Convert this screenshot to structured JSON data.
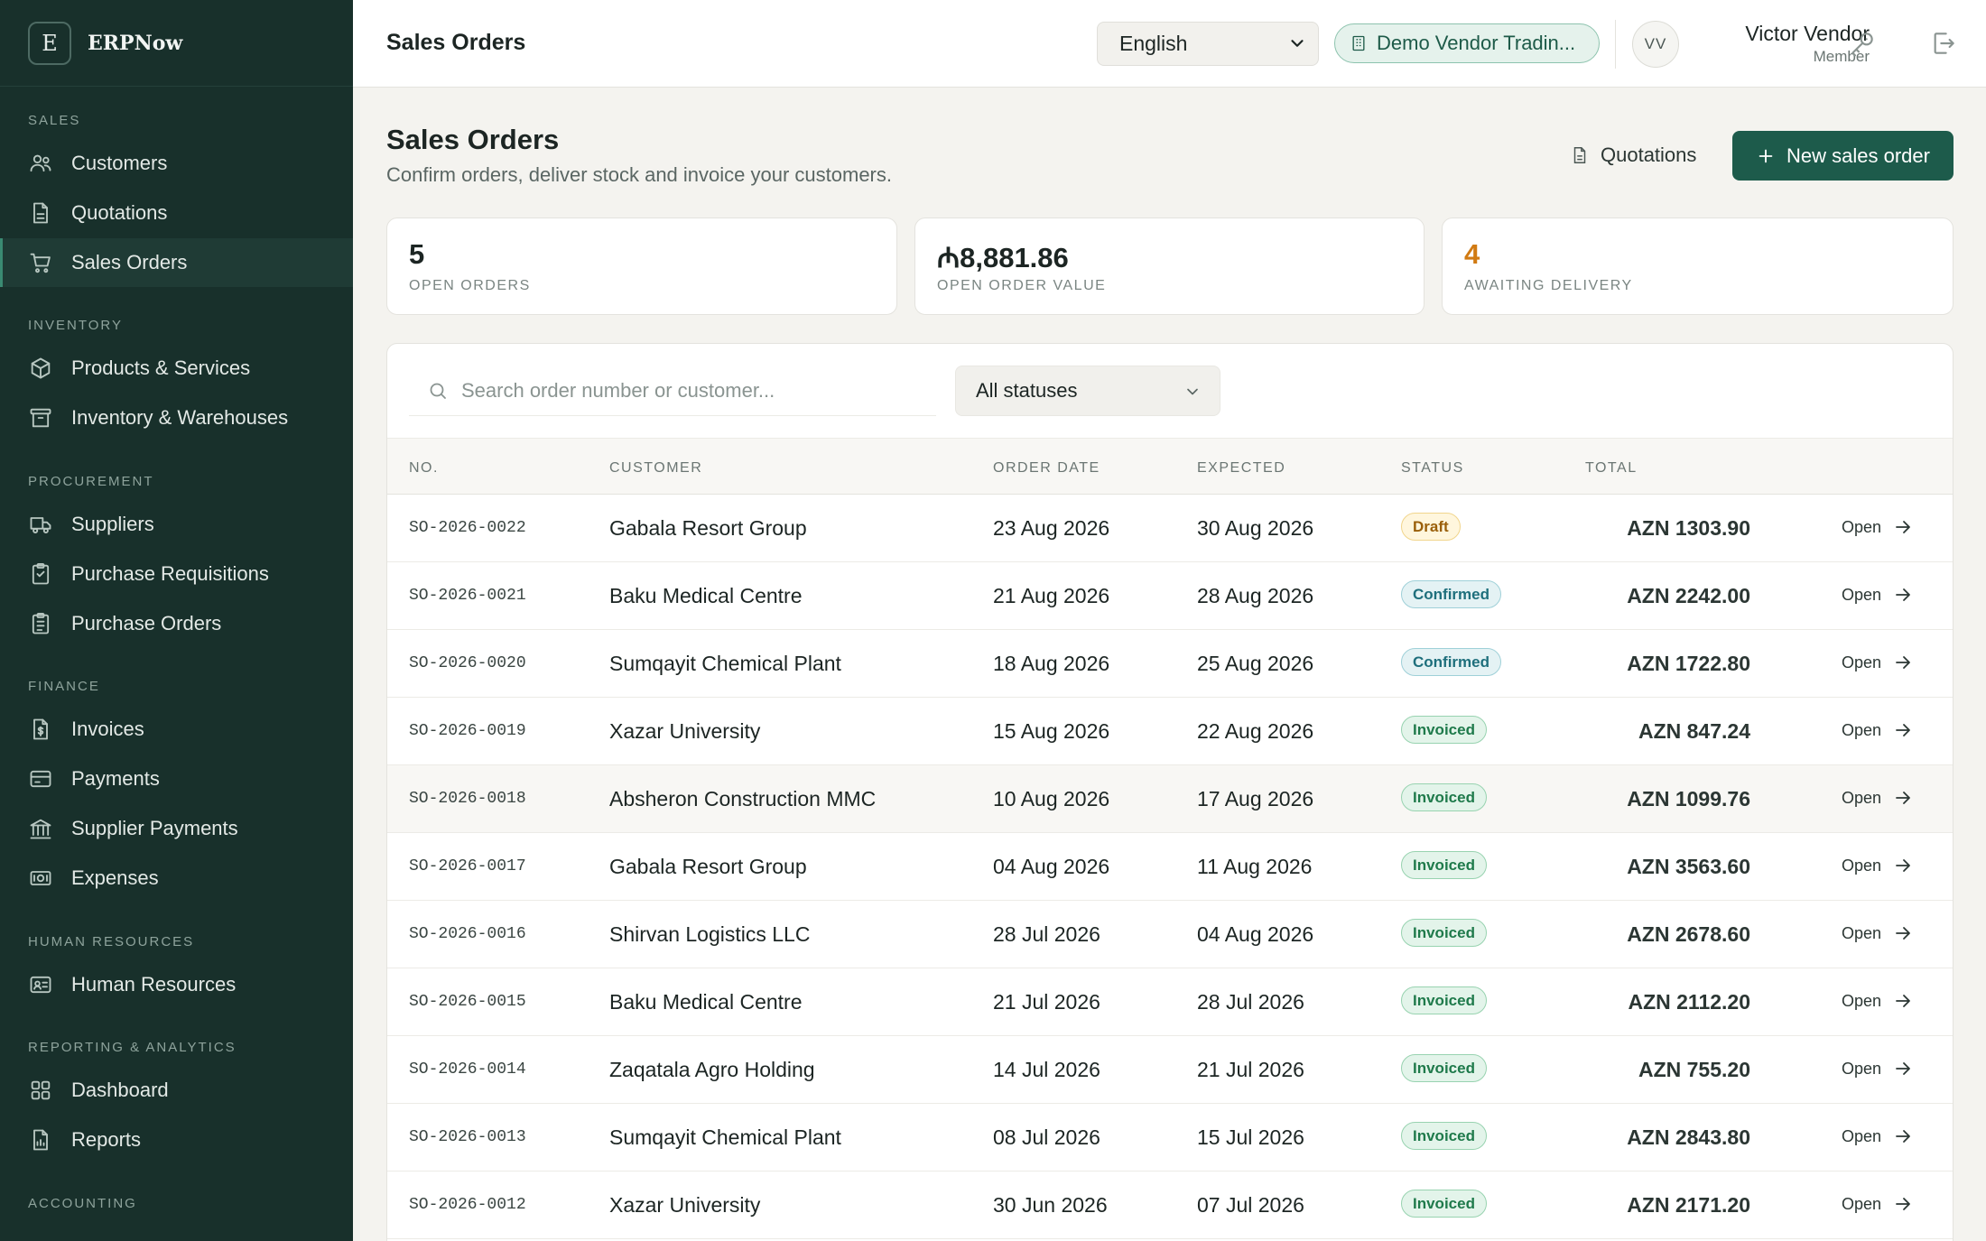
{
  "brand": {
    "logo_letter": "E",
    "name": "ERPNow"
  },
  "sidebar": {
    "sections": [
      {
        "label": "SALES",
        "items": [
          {
            "label": "Customers",
            "icon": "users-icon"
          },
          {
            "label": "Quotations",
            "icon": "document-icon"
          },
          {
            "label": "Sales Orders",
            "icon": "cart-icon",
            "active": true
          }
        ]
      },
      {
        "label": "INVENTORY",
        "items": [
          {
            "label": "Products & Services",
            "icon": "box-icon"
          },
          {
            "label": "Inventory & Warehouses",
            "icon": "archive-icon"
          }
        ]
      },
      {
        "label": "PROCUREMENT",
        "items": [
          {
            "label": "Suppliers",
            "icon": "truck-icon"
          },
          {
            "label": "Purchase Requisitions",
            "icon": "clipboard-icon"
          },
          {
            "label": "Purchase Orders",
            "icon": "clipboard-list-icon"
          }
        ]
      },
      {
        "label": "FINANCE",
        "items": [
          {
            "label": "Invoices",
            "icon": "invoice-icon"
          },
          {
            "label": "Payments",
            "icon": "credit-card-icon"
          },
          {
            "label": "Supplier Payments",
            "icon": "bank-icon"
          },
          {
            "label": "Expenses",
            "icon": "banknote-icon"
          }
        ]
      },
      {
        "label": "HUMAN RESOURCES",
        "items": [
          {
            "label": "Human Resources",
            "icon": "id-card-icon"
          }
        ]
      },
      {
        "label": "REPORTING & ANALYTICS",
        "items": [
          {
            "label": "Dashboard",
            "icon": "grid-icon"
          },
          {
            "label": "Reports",
            "icon": "report-icon"
          }
        ]
      },
      {
        "label": "ACCOUNTING",
        "items": []
      }
    ]
  },
  "topbar": {
    "title": "Sales Orders",
    "language": "English",
    "company": "Demo Vendor Tradin...",
    "user_initials": "VV",
    "user_name": "Victor Vendor",
    "user_role": "Member"
  },
  "header": {
    "title": "Sales Orders",
    "subtitle": "Confirm orders, deliver stock and invoice your customers.",
    "quotations_button": "Quotations",
    "new_button": "New sales order"
  },
  "stats": [
    {
      "value": "5",
      "label": "OPEN ORDERS"
    },
    {
      "value": "₼8,881.86",
      "label": "OPEN ORDER VALUE"
    },
    {
      "value": "4",
      "label": "AWAITING DELIVERY",
      "accent": "#d17a12"
    }
  ],
  "filters": {
    "search_placeholder": "Search order number or customer...",
    "status": "All statuses"
  },
  "table": {
    "columns": [
      "NO.",
      "CUSTOMER",
      "ORDER DATE",
      "EXPECTED",
      "STATUS",
      "TOTAL"
    ],
    "open_label": "Open",
    "rows": [
      {
        "no": "SO-2026-0022",
        "customer": "Gabala Resort Group",
        "order_date": "23 Aug 2026",
        "expected": "30 Aug 2026",
        "status": "Draft",
        "total": "AZN 1303.90"
      },
      {
        "no": "SO-2026-0021",
        "customer": "Baku Medical Centre",
        "order_date": "21 Aug 2026",
        "expected": "28 Aug 2026",
        "status": "Confirmed",
        "total": "AZN 2242.00"
      },
      {
        "no": "SO-2026-0020",
        "customer": "Sumqayit Chemical Plant",
        "order_date": "18 Aug 2026",
        "expected": "25 Aug 2026",
        "status": "Confirmed",
        "total": "AZN 1722.80"
      },
      {
        "no": "SO-2026-0019",
        "customer": "Xazar University",
        "order_date": "15 Aug 2026",
        "expected": "22 Aug 2026",
        "status": "Invoiced",
        "total": "AZN 847.24"
      },
      {
        "no": "SO-2026-0018",
        "customer": "Absheron Construction MMC",
        "order_date": "10 Aug 2026",
        "expected": "17 Aug 2026",
        "status": "Invoiced",
        "total": "AZN 1099.76",
        "hover": true
      },
      {
        "no": "SO-2026-0017",
        "customer": "Gabala Resort Group",
        "order_date": "04 Aug 2026",
        "expected": "11 Aug 2026",
        "status": "Invoiced",
        "total": "AZN 3563.60"
      },
      {
        "no": "SO-2026-0016",
        "customer": "Shirvan Logistics LLC",
        "order_date": "28 Jul 2026",
        "expected": "04 Aug 2026",
        "status": "Invoiced",
        "total": "AZN 2678.60"
      },
      {
        "no": "SO-2026-0015",
        "customer": "Baku Medical Centre",
        "order_date": "21 Jul 2026",
        "expected": "28 Jul 2026",
        "status": "Invoiced",
        "total": "AZN 2112.20"
      },
      {
        "no": "SO-2026-0014",
        "customer": "Zaqatala Agro Holding",
        "order_date": "14 Jul 2026",
        "expected": "21 Jul 2026",
        "status": "Invoiced",
        "total": "AZN 755.20"
      },
      {
        "no": "SO-2026-0013",
        "customer": "Sumqayit Chemical Plant",
        "order_date": "08 Jul 2026",
        "expected": "15 Jul 2026",
        "status": "Invoiced",
        "total": "AZN 2843.80"
      },
      {
        "no": "SO-2026-0012",
        "customer": "Xazar University",
        "order_date": "30 Jun 2026",
        "expected": "07 Jul 2026",
        "status": "Invoiced",
        "total": "AZN 2171.20"
      }
    ]
  }
}
